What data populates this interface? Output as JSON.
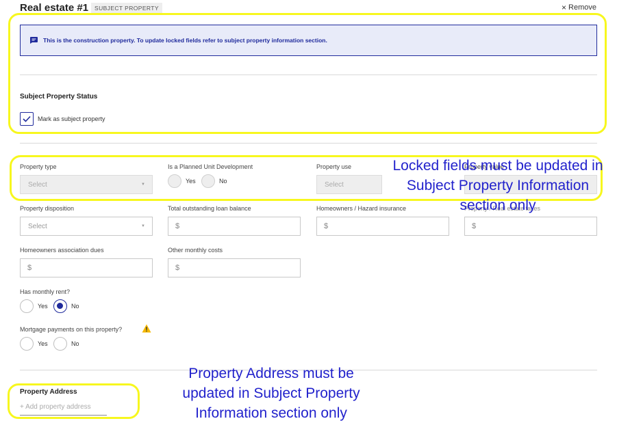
{
  "header": {
    "title": "Real estate #1",
    "badge": "SUBJECT PROPERTY",
    "remove_label": "Remove"
  },
  "notice": {
    "text": "This is the construction property. To update locked fields refer to subject property information section."
  },
  "status": {
    "title": "Subject Property Status",
    "checkbox_label": "Mark as subject property",
    "checked": true
  },
  "fields": {
    "property_type": {
      "label": "Property type",
      "value": "Select"
    },
    "pud": {
      "label": "Is a Planned Unit Development",
      "yes": "Yes",
      "no": "No"
    },
    "property_use": {
      "label": "Property use",
      "value": "Select"
    },
    "property_value": {
      "label": "Property value"
    },
    "disposition": {
      "label": "Property disposition",
      "value": "Select"
    },
    "loan_balance": {
      "label": "Total outstanding loan balance",
      "prefix": "$"
    },
    "hazard": {
      "label": "Homeowners / Hazard insurance",
      "prefix": "$"
    },
    "taxes": {
      "label": "Property / Real estate taxes",
      "prefix": "$"
    },
    "hoa": {
      "label": "Homeowners association dues",
      "prefix": "$"
    },
    "other_costs": {
      "label": "Other monthly costs",
      "prefix": "$"
    },
    "monthly_rent": {
      "label": "Has monthly rent?",
      "yes": "Yes",
      "no": "No",
      "selected": "No"
    },
    "mortgage": {
      "label": "Mortgage payments on this property?",
      "yes": "Yes",
      "no": "No"
    }
  },
  "address": {
    "title": "Property Address",
    "add_label": "+ Add property address"
  },
  "annotations": {
    "locked_line1": "Locked fields must be updated in",
    "locked_line2": "Subject Property Information",
    "locked_line3": "section only",
    "address_line1": "Property Address must be",
    "address_line2": "updated in Subject Property",
    "address_line3": "Information section only"
  },
  "colors": {
    "accent": "#1f2a9c",
    "highlight": "#f7f71e",
    "annotation": "#2222cc",
    "warning": "#f5b800"
  }
}
